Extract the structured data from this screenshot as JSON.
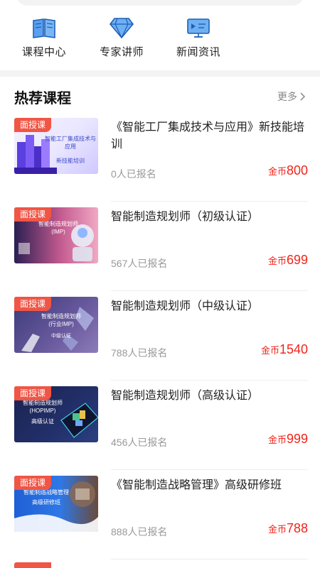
{
  "quick_nav": [
    {
      "label": "课程中心",
      "icon": "book-icon"
    },
    {
      "label": "专家讲师",
      "icon": "diamond-icon"
    },
    {
      "label": "新闻资讯",
      "icon": "monitor-icon"
    }
  ],
  "section": {
    "title": "热荐课程",
    "more": "更多"
  },
  "courses": [
    {
      "tag": "面授课",
      "title": "《智能工厂集成技术与应用》新技能培训",
      "enrolled": "0人已报名",
      "price_unit": "金币",
      "price": "800",
      "thumb_lines": [
        "智能工厂集成技术与应用",
        "新技能培训"
      ]
    },
    {
      "tag": "面授课",
      "title": "智能制造规划师（初级认证）",
      "enrolled": "567人已报名",
      "price_unit": "金币",
      "price": "699",
      "thumb_lines": [
        "智能制造规划师",
        "(IMP)"
      ]
    },
    {
      "tag": "面授课",
      "title": "智能制造规划师（中级认证）",
      "enrolled": "788人已报名",
      "price_unit": "金币",
      "price": "1540",
      "thumb_lines": [
        "智能制造规划师",
        "(行业IMP)",
        "中级认证"
      ]
    },
    {
      "tag": "面授课",
      "title": "智能制造规划师（高级认证）",
      "enrolled": "456人已报名",
      "price_unit": "金币",
      "price": "999",
      "thumb_lines": [
        "智能制造规划师",
        "(HOPIMP)",
        "高级认证"
      ]
    },
    {
      "tag": "面授课",
      "title": "《智能制造战略管理》高级研修班",
      "enrolled": "888人已报名",
      "price_unit": "金币",
      "price": "788",
      "thumb_lines": [
        "智能制造战略管理",
        "高级研修班"
      ]
    }
  ],
  "colors": {
    "accent": "#f2241a",
    "tag": "#f05545",
    "icon_blue": "#2f7bd8"
  }
}
